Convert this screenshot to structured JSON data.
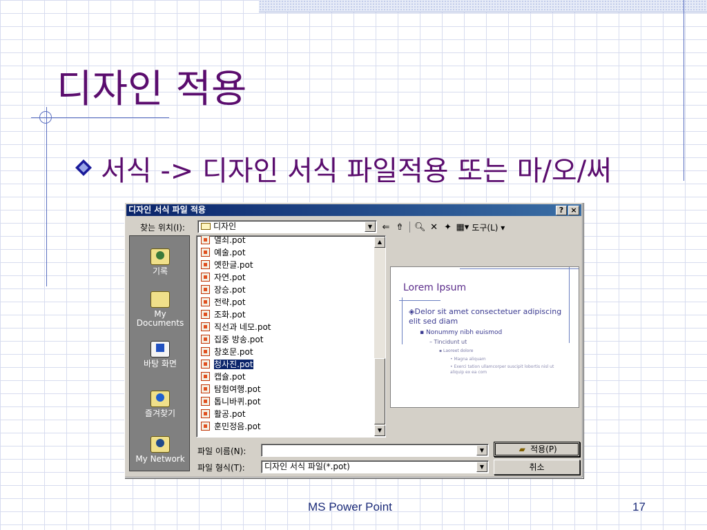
{
  "slide": {
    "title": "디자인 적용",
    "bullet": "서식 -> 디자인 서식 파일적용 또는 마/오/써",
    "footer": "MS Power Point",
    "page_number": "17"
  },
  "dialog": {
    "title": "디자인 서식 파일 적용",
    "help_button": "?",
    "close_button": "×",
    "look_in_label": "찾는 위치(I):",
    "look_in_value": "디자인",
    "tools_label": "도구(L)",
    "places": [
      {
        "label": "기록",
        "icon": "history-icon"
      },
      {
        "label": "My Documents",
        "icon": "my-documents-icon"
      },
      {
        "label": "바탕 화면",
        "icon": "desktop-icon"
      },
      {
        "label": "즐겨찾기",
        "icon": "favorites-icon"
      },
      {
        "label": "My Network",
        "icon": "network-icon"
      }
    ],
    "files": [
      "열쇠.pot",
      "예술.pot",
      "옛한글.pot",
      "자연.pot",
      "장승.pot",
      "전략.pot",
      "조화.pot",
      "직선과 네모.pot",
      "집중 방송.pot",
      "창호문.pot",
      "청사진.pot",
      "캡슐.pot",
      "탐험여행.pot",
      "톱니바퀴.pot",
      "활공.pot",
      "훈민정음.pot"
    ],
    "selected_file": "청사진.pot",
    "preview": {
      "title": "Lorem Ipsum",
      "line1": "Delor sit amet consectetuer adipiscing elit sed diam",
      "line2": "Nonummy nibh euismod",
      "line3": "Tincidunt ut",
      "line4": "Laoreet dolore",
      "line5": "Magna aliquam",
      "line6": "Exerci tation ullamcorper suscipit lobortis nisl ut aliquip ex ea com"
    },
    "file_name_label": "파일 이름(N):",
    "file_name_value": "",
    "file_type_label": "파일 형식(T):",
    "file_type_value": "디자인 서식 파일(*.pot)",
    "apply_button": "적용(P)",
    "cancel_button": "취소"
  }
}
